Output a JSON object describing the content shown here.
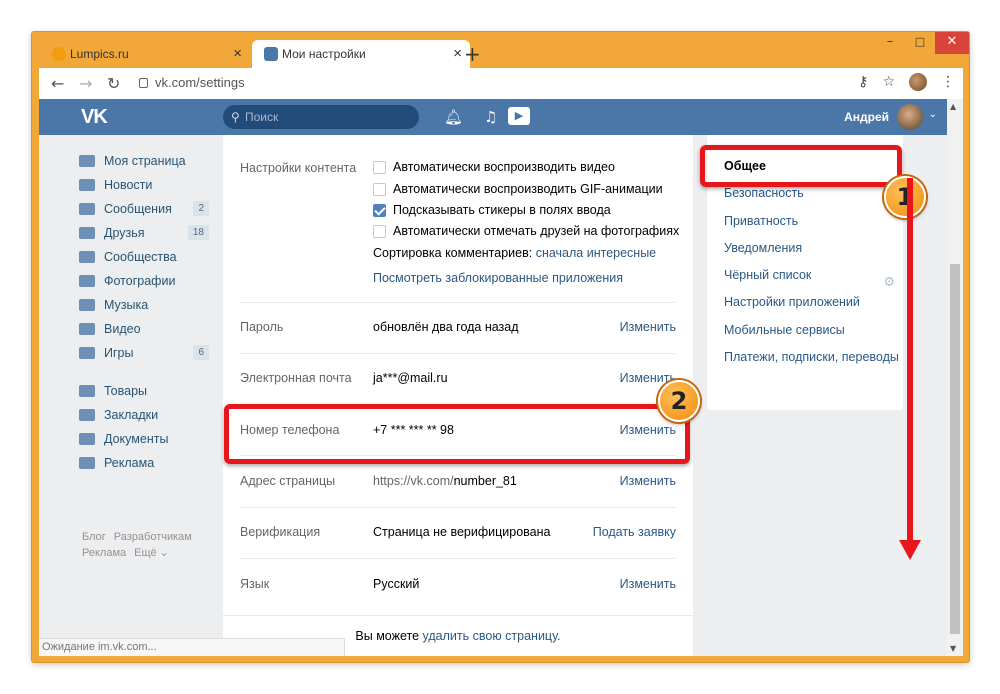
{
  "browser": {
    "tabs": [
      {
        "title": "Lumpics.ru",
        "favicon_color": "#f39c12"
      },
      {
        "title": "Мои настройки",
        "favicon_color": "#4a76a8"
      }
    ],
    "url": "vk.com/settings",
    "window_controls": {
      "minimize": "–",
      "maximize": "□",
      "close": "✕"
    },
    "status": "Ожидание im.vk.com..."
  },
  "header": {
    "logo": "VK",
    "search_placeholder": "Поиск",
    "user_name": "Андрей"
  },
  "left_menu": {
    "items": [
      {
        "label": "Моя страница",
        "icon": "home-icon"
      },
      {
        "label": "Новости",
        "icon": "news-icon"
      },
      {
        "label": "Сообщения",
        "icon": "messages-icon",
        "badge": "2"
      },
      {
        "label": "Друзья",
        "icon": "friends-icon",
        "badge": "18"
      },
      {
        "label": "Сообщества",
        "icon": "communities-icon"
      },
      {
        "label": "Фотографии",
        "icon": "photo-icon"
      },
      {
        "label": "Музыка",
        "icon": "music-icon"
      },
      {
        "label": "Видео",
        "icon": "video-icon"
      },
      {
        "label": "Игры",
        "icon": "games-icon",
        "badge": "6"
      }
    ],
    "items2": [
      {
        "label": "Товары",
        "icon": "goods-icon"
      },
      {
        "label": "Закладки",
        "icon": "bookmarks-icon"
      },
      {
        "label": "Документы",
        "icon": "documents-icon"
      },
      {
        "label": "Реклама",
        "icon": "ads-icon"
      }
    ],
    "footer": [
      "Блог",
      "Разработчикам",
      "Реклама",
      "Ещё ⌄"
    ]
  },
  "settings": {
    "content": {
      "label": "Настройки контента",
      "options": [
        {
          "text": "Автоматически воспроизводить видео",
          "checked": false
        },
        {
          "text": "Автоматически воспроизводить GIF-анимации",
          "checked": false
        },
        {
          "text": "Подсказывать стикеры в полях ввода",
          "checked": true
        },
        {
          "text": "Автоматически отмечать друзей на фотографиях",
          "checked": false
        }
      ],
      "sort_label": "Сортировка комментариев:",
      "sort_value": "сначала интересные",
      "blocked_apps": "Посмотреть заблокированные приложения"
    },
    "rows": [
      {
        "label": "Пароль",
        "value": "обновлён два года назад",
        "action": "Изменить"
      },
      {
        "label": "Электронная почта",
        "value": "ja***@mail.ru",
        "action": "Изменить"
      },
      {
        "label": "Номер телефона",
        "value": "+7 *** *** ** 98",
        "action": "Изменить"
      },
      {
        "label": "Адрес страницы",
        "value_prefix": "https://vk.com/",
        "value_link": "number_81",
        "action": "Изменить"
      },
      {
        "label": "Верификация",
        "value": "Страница не верифицирована",
        "action": "Подать заявку"
      },
      {
        "label": "Язык",
        "value": "Русский",
        "action": "Изменить"
      }
    ],
    "footer_text": "Вы можете",
    "footer_link": "удалить свою страницу."
  },
  "right_menu": {
    "items": [
      "Общее",
      "Безопасность",
      "Приватность",
      "Уведомления",
      "Чёрный список",
      "Настройки приложений",
      "Мобильные сервисы",
      "Платежи, подписки, переводы"
    ]
  },
  "annotations": {
    "marker1": "1",
    "marker2": "2",
    "color": "#e8151a"
  }
}
